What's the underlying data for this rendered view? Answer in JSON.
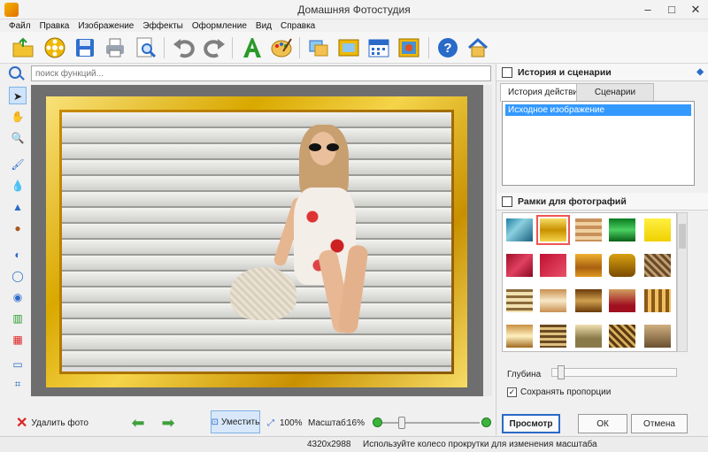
{
  "window": {
    "title": "Домашняя Фотостудия",
    "minimize": "–",
    "maximize": "□",
    "close": "✕"
  },
  "menu": [
    "Файл",
    "Правка",
    "Изображение",
    "Эффекты",
    "Оформление",
    "Вид",
    "Справка"
  ],
  "toolbar_icons": [
    "open-folder-icon",
    "film-reel-icon",
    "save-icon",
    "print-icon",
    "zoom-page-icon",
    "undo-icon",
    "redo-icon",
    "text-icon",
    "palette-icon",
    "crop-icon",
    "frame-icon",
    "calendar-icon",
    "collage-icon",
    "help-icon",
    "home-icon"
  ],
  "search": {
    "placeholder": "поиск функций..."
  },
  "tools": {
    "pointer": "➤",
    "hand": "✋",
    "zoom": "🔍",
    "brush": "🖌",
    "drop": "💧",
    "bucket": "▲",
    "stamp": "●",
    "adjust": "◐",
    "lasso": "◯",
    "eye": "◉",
    "histogram": "▥",
    "mosaic": "▦",
    "eraser": "▭",
    "crop": "⌗"
  },
  "bottom": {
    "delete_label": "Удалить фото",
    "fit_label": "Уместить",
    "zoom_100": "100%",
    "scale_label": "Масштаб:",
    "scale_value": "16%",
    "scale_level": 0.16
  },
  "status": {
    "size": "4320x2988",
    "hint": "Используйте колесо прокрутки для изменения масштаба"
  },
  "history_panel": {
    "title": "История и сценарии",
    "tabs": [
      "История действий",
      "Сценарии"
    ],
    "items": [
      "Исходное изображение"
    ]
  },
  "frames_panel": {
    "title": "Рамки для фотографий",
    "depth_label": "Глубина",
    "keep_label": "Сохранять пропорции",
    "keep_checked": true,
    "selected_index": 1
  },
  "buttons": {
    "preview": "Просмотр",
    "ok": "ОК",
    "cancel": "Отмена"
  }
}
